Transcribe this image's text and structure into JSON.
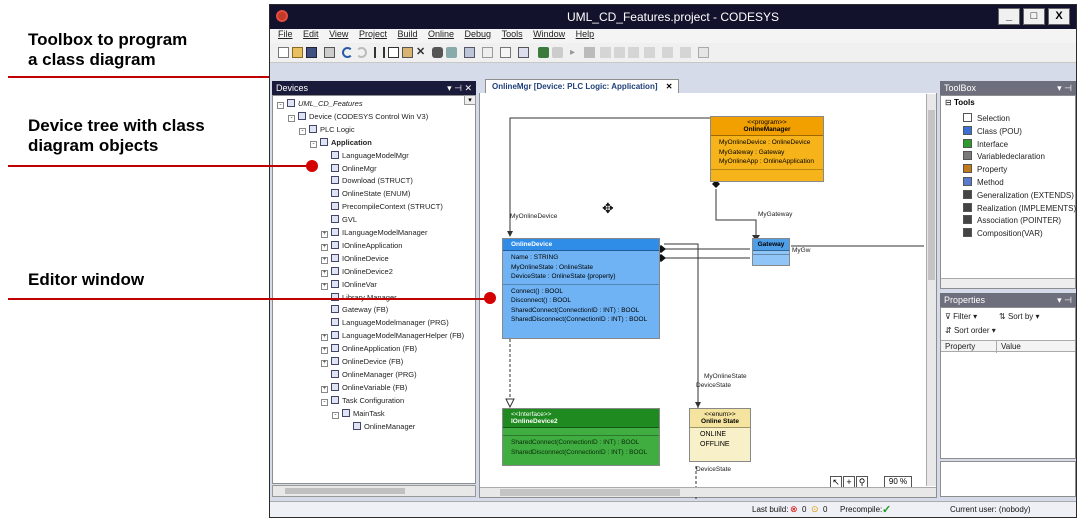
{
  "annotations": [
    {
      "label": "Toolbox to program\na class diagram"
    },
    {
      "label": "Device tree with class\ndiagram objects"
    },
    {
      "label": "Editor window"
    }
  ],
  "window": {
    "title": "UML_CD_Features.project - CODESYS",
    "min": "_",
    "max": "□",
    "close": "X"
  },
  "menu": [
    "File",
    "Edit",
    "View",
    "Project",
    "Build",
    "Online",
    "Debug",
    "Tools",
    "Window",
    "Help"
  ],
  "devices_panel": {
    "title": "Devices",
    "controls": "▾ ⊣ ✕",
    "items": [
      {
        "label": "UML_CD_Features",
        "indent": 0,
        "pm": "-"
      },
      {
        "label": "Device (CODESYS Control Win V3)",
        "indent": 1,
        "pm": "-"
      },
      {
        "label": "PLC Logic",
        "indent": 2,
        "pm": "-"
      },
      {
        "label": "Application",
        "indent": 3,
        "pm": "-",
        "bold": true
      },
      {
        "label": "LanguageModelMgr",
        "indent": 4
      },
      {
        "label": "OnlineMgr",
        "indent": 4
      },
      {
        "label": "Download (STRUCT)",
        "indent": 4
      },
      {
        "label": "OnlineState (ENUM)",
        "indent": 4
      },
      {
        "label": "PrecompileContext (STRUCT)",
        "indent": 4
      },
      {
        "label": "GVL",
        "indent": 4
      },
      {
        "label": "ILanguageModelManager",
        "indent": 4,
        "pm": "+"
      },
      {
        "label": "IOnlineApplication",
        "indent": 4,
        "pm": "+"
      },
      {
        "label": "IOnlineDevice",
        "indent": 4,
        "pm": "+"
      },
      {
        "label": "IOnlineDevice2",
        "indent": 4,
        "pm": "+"
      },
      {
        "label": "IOnlineVar",
        "indent": 4,
        "pm": "+"
      },
      {
        "label": "Library Manager",
        "indent": 4
      },
      {
        "label": "Gateway (FB)",
        "indent": 4
      },
      {
        "label": "LanguageModelmanager (PRG)",
        "indent": 4
      },
      {
        "label": "LanguageModelManagerHelper (FB)",
        "indent": 4,
        "pm": "+"
      },
      {
        "label": "OnlineApplication (FB)",
        "indent": 4,
        "pm": "+"
      },
      {
        "label": "OnlineDevice (FB)",
        "indent": 4,
        "pm": "+"
      },
      {
        "label": "OnlineManager (PRG)",
        "indent": 4
      },
      {
        "label": "OnlineVariable (FB)",
        "indent": 4,
        "pm": "+"
      },
      {
        "label": "Task Configuration",
        "indent": 4,
        "pm": "-"
      },
      {
        "label": "MainTask",
        "indent": 5,
        "pm": "-"
      },
      {
        "label": "OnlineManager",
        "indent": 6
      }
    ]
  },
  "editor": {
    "tab_label": "OnlineMgr [Device: PLC Logic: Application]",
    "tab_close": "✕",
    "zoom": "90 %",
    "classes": {
      "online_manager": {
        "stereotype": "<<program>>",
        "name": "OnlineManager",
        "attrs": [
          "MyOnlineDevice : OnlineDevice",
          "MyGateway : Gateway",
          "MyOnlineApp : OnlineApplication"
        ]
      },
      "online_device": {
        "name": "OnlineDevice",
        "attrs": [
          "Name : STRING",
          "MyOnlineState : OnlineState",
          "DeviceState : OnlineState {property}"
        ],
        "methods": [
          "Connect() : BOOL",
          "Disconnect() : BOOL",
          "SharedConnect(ConnectionID : INT) : BOOL",
          "SharedDisconnect(ConnectionID : INT) : BOOL"
        ]
      },
      "gateway": {
        "name": "Gateway"
      },
      "ionline_device2": {
        "stereotype": "<<Interface>>",
        "name": "IOnlineDevice2",
        "methods": [
          "SharedConnect(ConnectionID : INT) : BOOL",
          "SharedDisconnect(ConnectionID : INT) : BOOL"
        ]
      },
      "online_state": {
        "stereotype": "<<enum>>",
        "name": "Online State",
        "values": [
          "ONLINE",
          "OFFLINE"
        ]
      }
    },
    "edge_labels": {
      "my_online_device": "MyOnlineDevice",
      "my_gateway": "MyGateway",
      "my_gw": "MyGw",
      "my_online_state": "MyOnlineState",
      "device_state_1": "DeviceState",
      "device_state_2": "DeviceState"
    }
  },
  "toolbox": {
    "title": "ToolBox",
    "group": "Tools",
    "items": [
      {
        "label": "Selection",
        "color": "#ffffff"
      },
      {
        "label": "Class (POU)",
        "color": "#3a6fd8"
      },
      {
        "label": "Interface",
        "color": "#2e9a2e"
      },
      {
        "label": "Variabledeclaration",
        "color": "#7a7a7a"
      },
      {
        "label": "Property",
        "color": "#c07a1a"
      },
      {
        "label": "Method",
        "color": "#5a7ad0"
      },
      {
        "label": "Generalization (EXTENDS)",
        "color": "#444444"
      },
      {
        "label": "Realization (IMPLEMENTS)",
        "color": "#444444"
      },
      {
        "label": "Association (POINTER)",
        "color": "#444444"
      },
      {
        "label": "Composition(VAR)",
        "color": "#444444"
      }
    ]
  },
  "properties": {
    "title": "Properties",
    "filter": "Filter",
    "sort_by": "Sort by",
    "sort_order": "Sort order",
    "col_property": "Property",
    "col_value": "Value"
  },
  "status": {
    "last_build_label": "Last build:",
    "errors": "0",
    "warnings": "0",
    "precompile_label": "Precompile:",
    "current_user": "Current user: (nobody)"
  },
  "colors": {
    "accent_red": "#c00000",
    "title_bg": "#12122d",
    "program_orange": "#f6b31a",
    "class_blue": "#6fb3f5",
    "interface_green": "#3fad3f",
    "enum_yellow": "#f8f0c8"
  }
}
